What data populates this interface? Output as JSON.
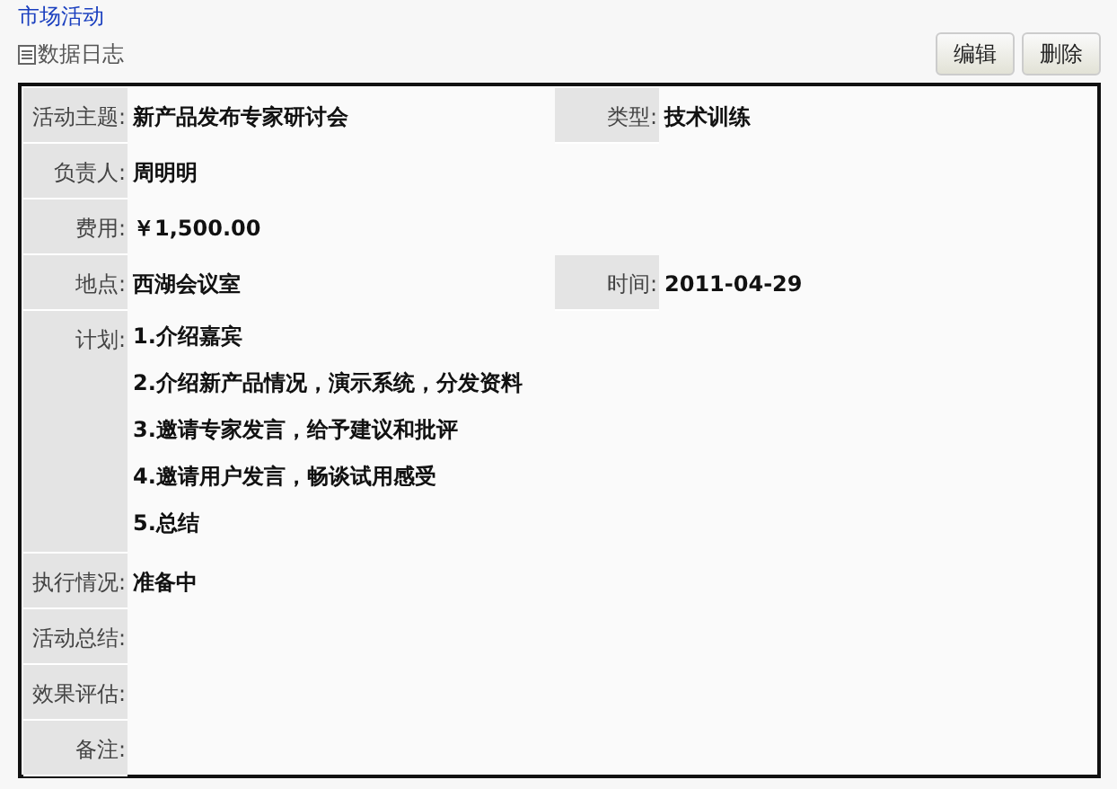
{
  "title": "市场活动",
  "subtitle": "数据日志",
  "buttons": [
    "编辑",
    "删除"
  ],
  "rows": [
    {
      "label": "活动主题:",
      "value": "新产品发布专家研讨会",
      "label_2": "类型:",
      "value_2": "技术训练"
    },
    {
      "label": "负责人:",
      "value": "周明明"
    },
    {
      "label": "费用:",
      "value": "￥1,500.00"
    },
    {
      "label": "地点:",
      "value": "西湖会议室",
      "label_2": "时间:",
      "value_2": "2011-04-29"
    },
    {
      "label": "计划:",
      "lines": [
        "1.介绍嘉宾",
        "2.介绍新产品情况，演示系统，分发资料",
        "3.邀请专家发言，给予建议和批评",
        "4.邀请用户发言，畅谈试用感受",
        "5.总结"
      ]
    },
    {
      "label": "执行情况:",
      "value": "准备中"
    },
    {
      "label": "活动总结:"
    },
    {
      "label": "效果评估:"
    },
    {
      "label": "备注:"
    }
  ]
}
